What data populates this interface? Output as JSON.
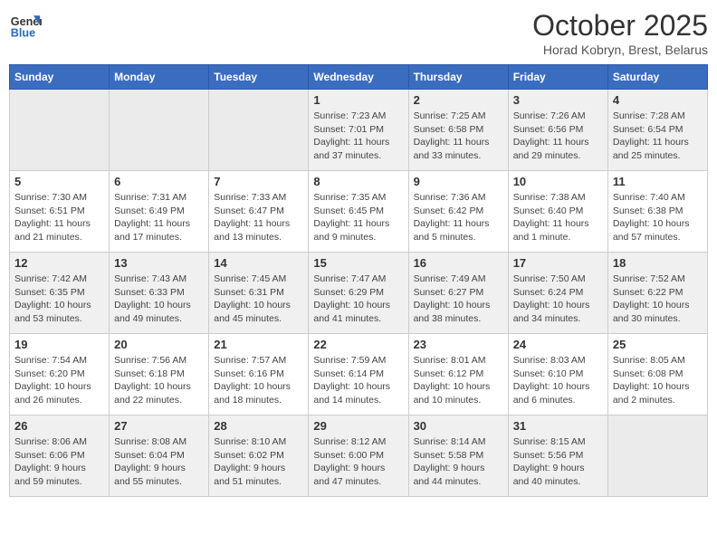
{
  "header": {
    "logo_line1": "General",
    "logo_line2": "Blue",
    "month_year": "October 2025",
    "location": "Horad Kobryn, Brest, Belarus"
  },
  "weekdays": [
    "Sunday",
    "Monday",
    "Tuesday",
    "Wednesday",
    "Thursday",
    "Friday",
    "Saturday"
  ],
  "weeks": [
    [
      {
        "day": "",
        "info": ""
      },
      {
        "day": "",
        "info": ""
      },
      {
        "day": "",
        "info": ""
      },
      {
        "day": "1",
        "info": "Sunrise: 7:23 AM\nSunset: 7:01 PM\nDaylight: 11 hours\nand 37 minutes."
      },
      {
        "day": "2",
        "info": "Sunrise: 7:25 AM\nSunset: 6:58 PM\nDaylight: 11 hours\nand 33 minutes."
      },
      {
        "day": "3",
        "info": "Sunrise: 7:26 AM\nSunset: 6:56 PM\nDaylight: 11 hours\nand 29 minutes."
      },
      {
        "day": "4",
        "info": "Sunrise: 7:28 AM\nSunset: 6:54 PM\nDaylight: 11 hours\nand 25 minutes."
      }
    ],
    [
      {
        "day": "5",
        "info": "Sunrise: 7:30 AM\nSunset: 6:51 PM\nDaylight: 11 hours\nand 21 minutes."
      },
      {
        "day": "6",
        "info": "Sunrise: 7:31 AM\nSunset: 6:49 PM\nDaylight: 11 hours\nand 17 minutes."
      },
      {
        "day": "7",
        "info": "Sunrise: 7:33 AM\nSunset: 6:47 PM\nDaylight: 11 hours\nand 13 minutes."
      },
      {
        "day": "8",
        "info": "Sunrise: 7:35 AM\nSunset: 6:45 PM\nDaylight: 11 hours\nand 9 minutes."
      },
      {
        "day": "9",
        "info": "Sunrise: 7:36 AM\nSunset: 6:42 PM\nDaylight: 11 hours\nand 5 minutes."
      },
      {
        "day": "10",
        "info": "Sunrise: 7:38 AM\nSunset: 6:40 PM\nDaylight: 11 hours\nand 1 minute."
      },
      {
        "day": "11",
        "info": "Sunrise: 7:40 AM\nSunset: 6:38 PM\nDaylight: 10 hours\nand 57 minutes."
      }
    ],
    [
      {
        "day": "12",
        "info": "Sunrise: 7:42 AM\nSunset: 6:35 PM\nDaylight: 10 hours\nand 53 minutes."
      },
      {
        "day": "13",
        "info": "Sunrise: 7:43 AM\nSunset: 6:33 PM\nDaylight: 10 hours\nand 49 minutes."
      },
      {
        "day": "14",
        "info": "Sunrise: 7:45 AM\nSunset: 6:31 PM\nDaylight: 10 hours\nand 45 minutes."
      },
      {
        "day": "15",
        "info": "Sunrise: 7:47 AM\nSunset: 6:29 PM\nDaylight: 10 hours\nand 41 minutes."
      },
      {
        "day": "16",
        "info": "Sunrise: 7:49 AM\nSunset: 6:27 PM\nDaylight: 10 hours\nand 38 minutes."
      },
      {
        "day": "17",
        "info": "Sunrise: 7:50 AM\nSunset: 6:24 PM\nDaylight: 10 hours\nand 34 minutes."
      },
      {
        "day": "18",
        "info": "Sunrise: 7:52 AM\nSunset: 6:22 PM\nDaylight: 10 hours\nand 30 minutes."
      }
    ],
    [
      {
        "day": "19",
        "info": "Sunrise: 7:54 AM\nSunset: 6:20 PM\nDaylight: 10 hours\nand 26 minutes."
      },
      {
        "day": "20",
        "info": "Sunrise: 7:56 AM\nSunset: 6:18 PM\nDaylight: 10 hours\nand 22 minutes."
      },
      {
        "day": "21",
        "info": "Sunrise: 7:57 AM\nSunset: 6:16 PM\nDaylight: 10 hours\nand 18 minutes."
      },
      {
        "day": "22",
        "info": "Sunrise: 7:59 AM\nSunset: 6:14 PM\nDaylight: 10 hours\nand 14 minutes."
      },
      {
        "day": "23",
        "info": "Sunrise: 8:01 AM\nSunset: 6:12 PM\nDaylight: 10 hours\nand 10 minutes."
      },
      {
        "day": "24",
        "info": "Sunrise: 8:03 AM\nSunset: 6:10 PM\nDaylight: 10 hours\nand 6 minutes."
      },
      {
        "day": "25",
        "info": "Sunrise: 8:05 AM\nSunset: 6:08 PM\nDaylight: 10 hours\nand 2 minutes."
      }
    ],
    [
      {
        "day": "26",
        "info": "Sunrise: 8:06 AM\nSunset: 6:06 PM\nDaylight: 9 hours\nand 59 minutes."
      },
      {
        "day": "27",
        "info": "Sunrise: 8:08 AM\nSunset: 6:04 PM\nDaylight: 9 hours\nand 55 minutes."
      },
      {
        "day": "28",
        "info": "Sunrise: 8:10 AM\nSunset: 6:02 PM\nDaylight: 9 hours\nand 51 minutes."
      },
      {
        "day": "29",
        "info": "Sunrise: 8:12 AM\nSunset: 6:00 PM\nDaylight: 9 hours\nand 47 minutes."
      },
      {
        "day": "30",
        "info": "Sunrise: 8:14 AM\nSunset: 5:58 PM\nDaylight: 9 hours\nand 44 minutes."
      },
      {
        "day": "31",
        "info": "Sunrise: 8:15 AM\nSunset: 5:56 PM\nDaylight: 9 hours\nand 40 minutes."
      },
      {
        "day": "",
        "info": ""
      }
    ]
  ]
}
